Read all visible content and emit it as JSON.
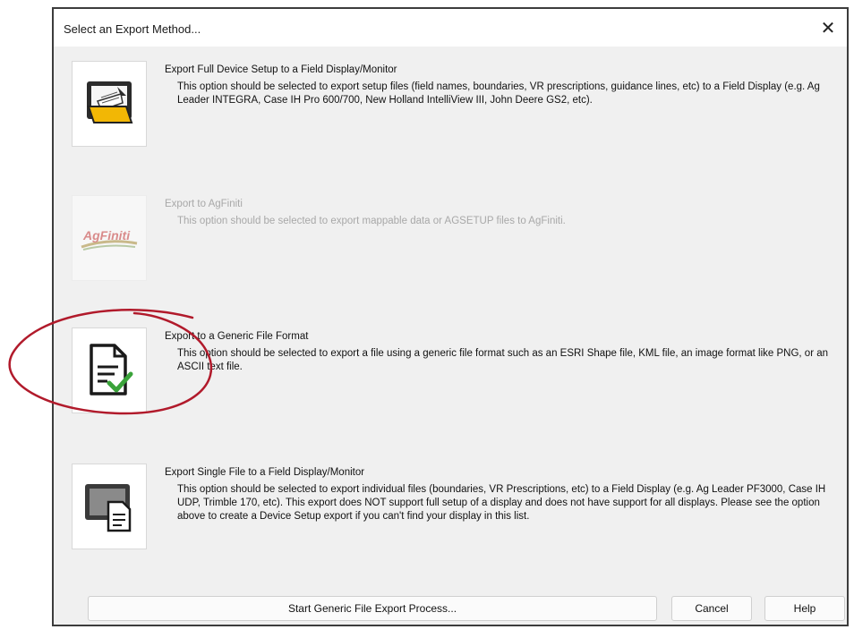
{
  "dialog": {
    "title": "Select an Export Method...",
    "close_glyph": "✕"
  },
  "options": [
    {
      "title": "Export Full Device Setup to a Field Display/Monitor",
      "description": "This option should be selected to export setup files (field names, boundaries, VR prescriptions, guidance lines, etc) to a Field Display (e.g. Ag Leader INTEGRA, Case IH Pro 600/700, New Holland IntelliView III, John Deere GS2, etc).",
      "icon": "folder-export-icon",
      "enabled": true
    },
    {
      "title": "Export to AgFiniti",
      "description": "This option should be selected to export mappable data or AGSETUP files to AgFiniti.",
      "icon": "agfiniti-logo",
      "logo_text": "AgFiniti",
      "enabled": false
    },
    {
      "title": "Export to a Generic File Format",
      "description": "This option should be selected to export a file using a generic file format such as an ESRI Shape file, KML file, an image format like PNG, or an ASCII text file.",
      "icon": "document-check-icon",
      "enabled": true,
      "highlighted": true
    },
    {
      "title": "Export Single File to a Field Display/Monitor",
      "description": "This option should be selected to export individual files (boundaries, VR Prescriptions, etc) to a Field Display (e.g. Ag Leader PF3000, Case IH UDP, Trimble 170, etc).  This export does NOT support full setup of a display and does not have support for all displays.  Please see the option above to create a Device Setup export if you can't find your display in this list.",
      "icon": "monitor-file-icon",
      "enabled": true
    }
  ],
  "buttons": {
    "start": "Start Generic File Export Process...",
    "cancel": "Cancel",
    "help": "Help"
  },
  "colors": {
    "annotation_circle": "#b11a2b",
    "check_green": "#3aa33a",
    "folder_yellow": "#f2b705",
    "disabled_text": "#a8a8a8"
  }
}
